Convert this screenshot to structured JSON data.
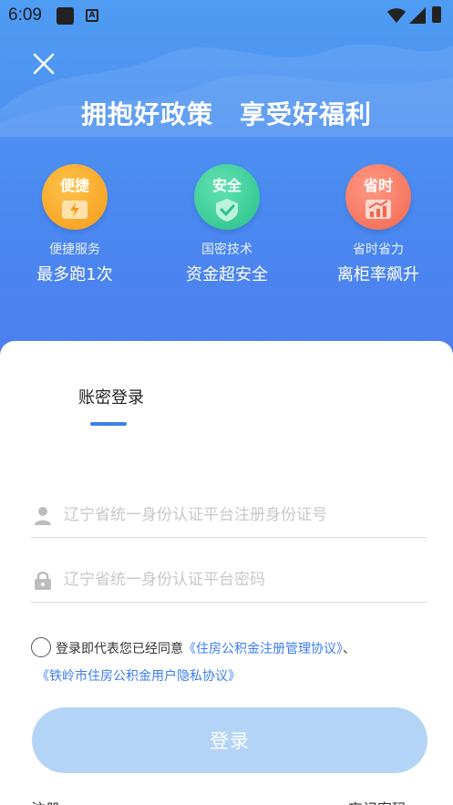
{
  "status_bar": {
    "time": "6:09",
    "a_icon": "A"
  },
  "hero": {
    "title": "拥抱好政策　享受好福利",
    "features": [
      {
        "badge": "便捷",
        "sub": "便捷服务",
        "main": "最多跑1次",
        "icon": "lightning-doc-icon"
      },
      {
        "badge": "安全",
        "sub": "国密技术",
        "main": "资金超安全",
        "icon": "shield-check-icon"
      },
      {
        "badge": "省时",
        "sub": "省时省力",
        "main": "离柜率飙升",
        "icon": "chart-up-icon"
      }
    ]
  },
  "login": {
    "tab_label": "账密登录",
    "id_placeholder": "辽宁省统一身份认证平台注册身份证号",
    "password_placeholder": "辽宁省统一身份认证平台密码",
    "agreement_prefix": "登录即代表您已经同意",
    "agreement_link1": "《住房公积金注册管理协议》",
    "agreement_sep": "、",
    "agreement_link2": "《铁岭市住房公积金用户隐私协议》",
    "login_button": "登录",
    "register_link": "注册",
    "forgot_link": "忘记密码"
  },
  "colors": {
    "accent": "#3d7ef0",
    "hero_top": "#4f9cf3",
    "button_disabled": "#b3d4f6"
  }
}
